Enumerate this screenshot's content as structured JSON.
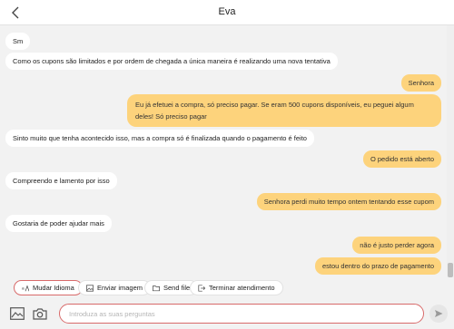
{
  "header": {
    "title": "Eva",
    "back_icon": "chevron-left-icon"
  },
  "messages": [
    {
      "side": "in",
      "text": "Sm"
    },
    {
      "side": "in",
      "text": "Como os cupons são limitados e por ordem de chegada a única maneira é realizando uma nova tentativa"
    },
    {
      "side": "out",
      "text": "Senhora"
    },
    {
      "side": "out",
      "text": "Eu já efetuei a compra, só preciso pagar. Se eram 500 cupons disponíveis, eu peguei algum deles! Só preciso pagar"
    },
    {
      "side": "in",
      "text": "Sinto muito que tenha acontecido isso, mas a compra só é finalizada quando o pagamento é feito"
    },
    {
      "side": "out",
      "text": "O pedido está aberto"
    },
    {
      "side": "in",
      "text": "Compreendo e lamento por isso"
    },
    {
      "side": "out",
      "text": "Senhora perdi muito tempo ontem tentando esse cupom"
    },
    {
      "side": "in",
      "text": "Gostaria de poder ajudar mais"
    },
    {
      "side": "out",
      "text": "não é justo perder agora"
    },
    {
      "side": "out",
      "text": "estou dentro do prazo de pagamento"
    }
  ],
  "quick_actions": {
    "change_language": "Mudar Idioma",
    "send_image": "Enviar imagem",
    "send_file": "Send file",
    "end_service": "Terminar atendimento"
  },
  "composer": {
    "placeholder": "Introduza as suas perguntas",
    "value": ""
  },
  "colors": {
    "outgoing_bubble": "#fdd37c",
    "incoming_bubble": "#ffffff",
    "accent_border": "#d86a6a",
    "background": "#f2f2f2"
  }
}
